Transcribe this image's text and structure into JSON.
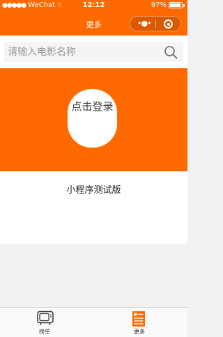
{
  "status_bar": {
    "signal": "●●●●●",
    "carrier": "WeChat",
    "wifi": "⌔",
    "time": "12:12",
    "battery": "97%"
  },
  "nav": {
    "title": "更多",
    "menu_glyph": "•●•"
  },
  "search": {
    "placeholder": "请输入电影名称",
    "value": "",
    "icon": "search-icon"
  },
  "hero": {
    "login_label": "点击登录"
  },
  "version": {
    "text": "小程序测试版"
  },
  "tab_bar": {
    "tabs": [
      {
        "label": "榜单",
        "icon": "tv-icon",
        "active": false
      },
      {
        "label": "更多",
        "icon": "more-list-icon",
        "active": true
      }
    ]
  },
  "colors": {
    "brand": "#ff6a00",
    "background": "#f2f2f2",
    "white": "#ffffff"
  }
}
